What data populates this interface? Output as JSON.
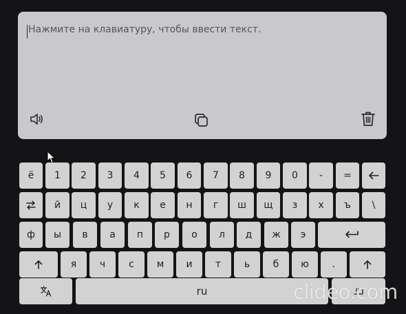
{
  "input": {
    "placeholder": "Нажмите на клавиатуру, чтобы ввести текст."
  },
  "panel_icons": {
    "speak": "speaker-icon",
    "copy": "copy-icon",
    "delete": "trash-icon"
  },
  "keyboard": {
    "row1": [
      "ё",
      "1",
      "2",
      "3",
      "4",
      "5",
      "6",
      "7",
      "8",
      "9",
      "0",
      "-",
      "="
    ],
    "row2": [
      "й",
      "ц",
      "у",
      "к",
      "е",
      "н",
      "г",
      "ш",
      "щ",
      "з",
      "х",
      "ъ",
      "\\"
    ],
    "row3": [
      "ф",
      "ы",
      "в",
      "а",
      "п",
      "р",
      "о",
      "л",
      "д",
      "ж",
      "э"
    ],
    "row4": [
      "я",
      "ч",
      "с",
      "м",
      "и",
      "т",
      "ь",
      "б",
      "ю",
      "."
    ],
    "space_label": "ru",
    "special_icons": {
      "backspace": "backspace-arrow-icon",
      "tab": "switch-arrows-icon",
      "enter": "enter-icon",
      "shift": "shift-arrow-icon",
      "translate": "translate-icon",
      "emoji": "emoji-icon"
    }
  },
  "watermark": "clideo.com"
}
